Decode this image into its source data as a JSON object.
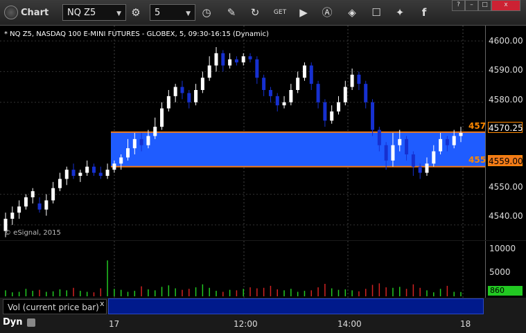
{
  "toolbar": {
    "title": "Chart",
    "symbol": "NQ Z5",
    "interval": "5",
    "icons": [
      "settings-icon",
      "clock-icon",
      "pencil-icon",
      "refresh-icon",
      "get-icon",
      "play-icon",
      "alert-icon",
      "tag-icon",
      "chat-icon",
      "twitter-icon",
      "facebook-icon"
    ],
    "window_buttons": [
      "?",
      "–",
      "□",
      "x"
    ]
  },
  "chart": {
    "header": "* NQ Z5, NASDAQ 100 E-MINI FUTURES - GLOBEX, 5, 09:30-16:15 (Dynamic)",
    "copyright": "© eSignal, 2015",
    "price_ticks": [
      "4600.00",
      "4590.00",
      "4580.00",
      "4550.00",
      "4540.00"
    ],
    "upper_label": "4570.25",
    "lower_label": "4559.00",
    "upper_clipped": "457",
    "lower_clipped": "455",
    "colors": {
      "band": "#1f5cff",
      "band_border": "#f07a1a",
      "up": "#ffffff",
      "down": "#1630d0",
      "vol_up": "#22c922",
      "vol_down": "#d22222"
    }
  },
  "chart_data": {
    "type": "candlestick",
    "ylim": [
      4535,
      4605
    ],
    "band": [
      4559.0,
      4570.25
    ],
    "candles": [
      [
        4538,
        4542,
        4536,
        4544
      ],
      [
        4542,
        4544,
        4540,
        4546
      ],
      [
        4544,
        4546,
        4542,
        4548
      ],
      [
        4546,
        4549,
        4545,
        4550
      ],
      [
        4549,
        4551,
        4547,
        4552
      ],
      [
        4547,
        4545,
        4544,
        4549
      ],
      [
        4545,
        4548,
        4543,
        4550
      ],
      [
        4548,
        4552,
        4547,
        4554
      ],
      [
        4552,
        4555,
        4551,
        4557
      ],
      [
        4555,
        4558,
        4553,
        4559
      ],
      [
        4558,
        4556,
        4555,
        4560
      ],
      [
        4556,
        4557,
        4554,
        4558
      ],
      [
        4557,
        4559,
        4556,
        4561
      ],
      [
        4559,
        4557,
        4556,
        4560
      ],
      [
        4557,
        4556,
        4555,
        4559
      ],
      [
        4556,
        4558,
        4555,
        4560
      ],
      [
        4558,
        4560,
        4557,
        4561
      ],
      [
        4560,
        4562,
        4558,
        4563
      ],
      [
        4562,
        4565,
        4561,
        4568
      ],
      [
        4565,
        4568,
        4563,
        4570
      ],
      [
        4568,
        4566,
        4564,
        4570
      ],
      [
        4566,
        4569,
        4565,
        4571
      ],
      [
        4569,
        4572,
        4568,
        4575
      ],
      [
        4572,
        4578,
        4571,
        4580
      ],
      [
        4578,
        4582,
        4577,
        4584
      ],
      [
        4582,
        4585,
        4580,
        4586
      ],
      [
        4585,
        4583,
        4581,
        4587
      ],
      [
        4583,
        4580,
        4578,
        4584
      ],
      [
        4580,
        4584,
        4579,
        4586
      ],
      [
        4584,
        4588,
        4583,
        4590
      ],
      [
        4588,
        4592,
        4587,
        4595
      ],
      [
        4592,
        4596,
        4590,
        4598
      ],
      [
        4596,
        4592,
        4590,
        4597
      ],
      [
        4592,
        4594,
        4591,
        4596
      ],
      [
        4594,
        4593,
        4592,
        4595
      ],
      [
        4593,
        4595,
        4592,
        4596
      ],
      [
        4595,
        4594,
        4593,
        4596
      ],
      [
        4594,
        4588,
        4586,
        4595
      ],
      [
        4588,
        4584,
        4582,
        4589
      ],
      [
        4584,
        4582,
        4580,
        4585
      ],
      [
        4582,
        4579,
        4577,
        4583
      ],
      [
        4579,
        4580,
        4578,
        4582
      ],
      [
        4580,
        4584,
        4579,
        4586
      ],
      [
        4584,
        4588,
        4583,
        4590
      ],
      [
        4588,
        4592,
        4587,
        4593
      ],
      [
        4592,
        4586,
        4584,
        4593
      ],
      [
        4586,
        4580,
        4578,
        4587
      ],
      [
        4580,
        4574,
        4572,
        4581
      ],
      [
        4574,
        4577,
        4573,
        4579
      ],
      [
        4577,
        4580,
        4576,
        4582
      ],
      [
        4580,
        4585,
        4579,
        4587
      ],
      [
        4585,
        4589,
        4584,
        4591
      ],
      [
        4589,
        4586,
        4584,
        4590
      ],
      [
        4586,
        4580,
        4578,
        4587
      ],
      [
        4580,
        4571,
        4569,
        4581
      ],
      [
        4571,
        4566,
        4564,
        4572
      ],
      [
        4566,
        4561,
        4558,
        4567
      ],
      [
        4561,
        4566,
        4559,
        4570
      ],
      [
        4566,
        4568,
        4564,
        4571
      ],
      [
        4568,
        4563,
        4561,
        4569
      ],
      [
        4563,
        4559,
        4556,
        4564
      ],
      [
        4559,
        4557,
        4555,
        4560
      ],
      [
        4557,
        4560,
        4556,
        4562
      ],
      [
        4560,
        4564,
        4559,
        4566
      ],
      [
        4564,
        4568,
        4563,
        4570
      ],
      [
        4568,
        4566,
        4564,
        4569
      ],
      [
        4566,
        4569,
        4565,
        4571
      ],
      [
        4569,
        4570,
        4567,
        4572
      ]
    ],
    "volume": [
      1200,
      800,
      900,
      1500,
      1100,
      1300,
      900,
      1000,
      1400,
      1200,
      1700,
      1100,
      900,
      800,
      1600,
      7200,
      1500,
      1300,
      900,
      1100,
      2000,
      1400,
      1200,
      1900,
      2200,
      1600,
      1300,
      1500,
      1800,
      2400,
      1700,
      1100,
      900,
      1300,
      1200,
      1500,
      1800,
      1600,
      1700,
      2100,
      1400,
      1200,
      1500,
      900,
      1100,
      1200,
      1800,
      2500,
      1600,
      1300,
      1400,
      1200,
      1000,
      1500,
      2300,
      2600,
      1800,
      1700,
      1900,
      1500,
      2400,
      1700,
      1200,
      800,
      1500,
      2100,
      900,
      860
    ],
    "volume_ticks": [
      "10000",
      "5000"
    ],
    "volume_value": "860",
    "x_ticks": [
      "17",
      "12:00",
      "14:00",
      "18"
    ]
  },
  "volume_panel": {
    "legend": "Vol (current price bar)",
    "close": "x"
  },
  "footer": {
    "dyn": "Dyn"
  }
}
